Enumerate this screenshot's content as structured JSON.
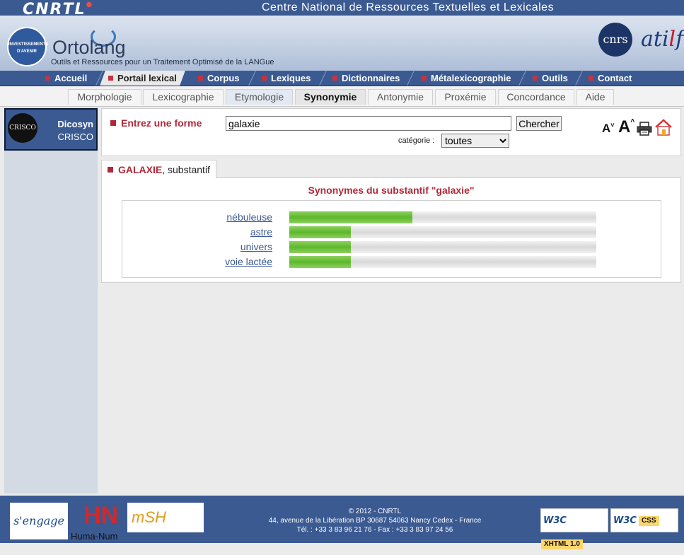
{
  "header": {
    "logo_text": "CNRTL",
    "title": "Centre National de Ressources Textuelles et Lexicales",
    "ortolang_name": "Ortolang",
    "ortolang_subtitle": "Outils et Ressources pour un Traitement Optimisé de la LANGue",
    "invest_logo_text": "INVESTISSEMENTS D'AVENIR",
    "cnrs_logo_text": "cnrs",
    "atilf_logo_text": "atilf"
  },
  "main_menu": [
    {
      "label": "Accueil"
    },
    {
      "label": "Portail lexical",
      "active": true
    },
    {
      "label": "Corpus"
    },
    {
      "label": "Lexiques"
    },
    {
      "label": "Dictionnaires"
    },
    {
      "label": "Métalexicographie"
    },
    {
      "label": "Outils"
    },
    {
      "label": "Contact"
    }
  ],
  "sub_tabs": [
    {
      "label": "Morphologie"
    },
    {
      "label": "Lexicographie"
    },
    {
      "label": "Etymologie"
    },
    {
      "label": "Synonymie",
      "active": true
    },
    {
      "label": "Antonymie"
    },
    {
      "label": "Proxémie"
    },
    {
      "label": "Concordance"
    },
    {
      "label": "Aide"
    }
  ],
  "sidebar": {
    "dicosyn_name": "Dicosyn",
    "dicosyn_sub": "CRISCO",
    "crisco_logo_text": "CRISCO"
  },
  "search": {
    "label": "Entrez une forme",
    "value": "galaxie",
    "button": "Chercher",
    "category_label": "catégorie :",
    "category_value": "toutes",
    "font_smaller": "A",
    "font_larger": "A"
  },
  "result": {
    "tab_word": "GALAXIE",
    "tab_pos": ", substantif",
    "title": "Synonymes du substantif \"galaxie\"",
    "synonyms": [
      {
        "word": "nébuleuse",
        "score": 0.4
      },
      {
        "word": "astre",
        "score": 0.2
      },
      {
        "word": "univers",
        "score": 0.2
      },
      {
        "word": "voie lactée",
        "score": 0.2
      }
    ]
  },
  "footer": {
    "europe_logo_text": "s'engage",
    "humanum_logo_text": "Huma-Num",
    "msh_logo_text": "mSH",
    "copyright": "© 2012 - CNRTL",
    "address": "44, avenue de la Libération BP 30687 54063 Nancy Cedex - France",
    "phone": "Tél. : +33 3 83 96 21 76 - Fax : +33 3 83 97 24 56",
    "w3c": "W3C",
    "xhtml_badge": "XHTML 1.0",
    "css_badge": "CSS"
  }
}
